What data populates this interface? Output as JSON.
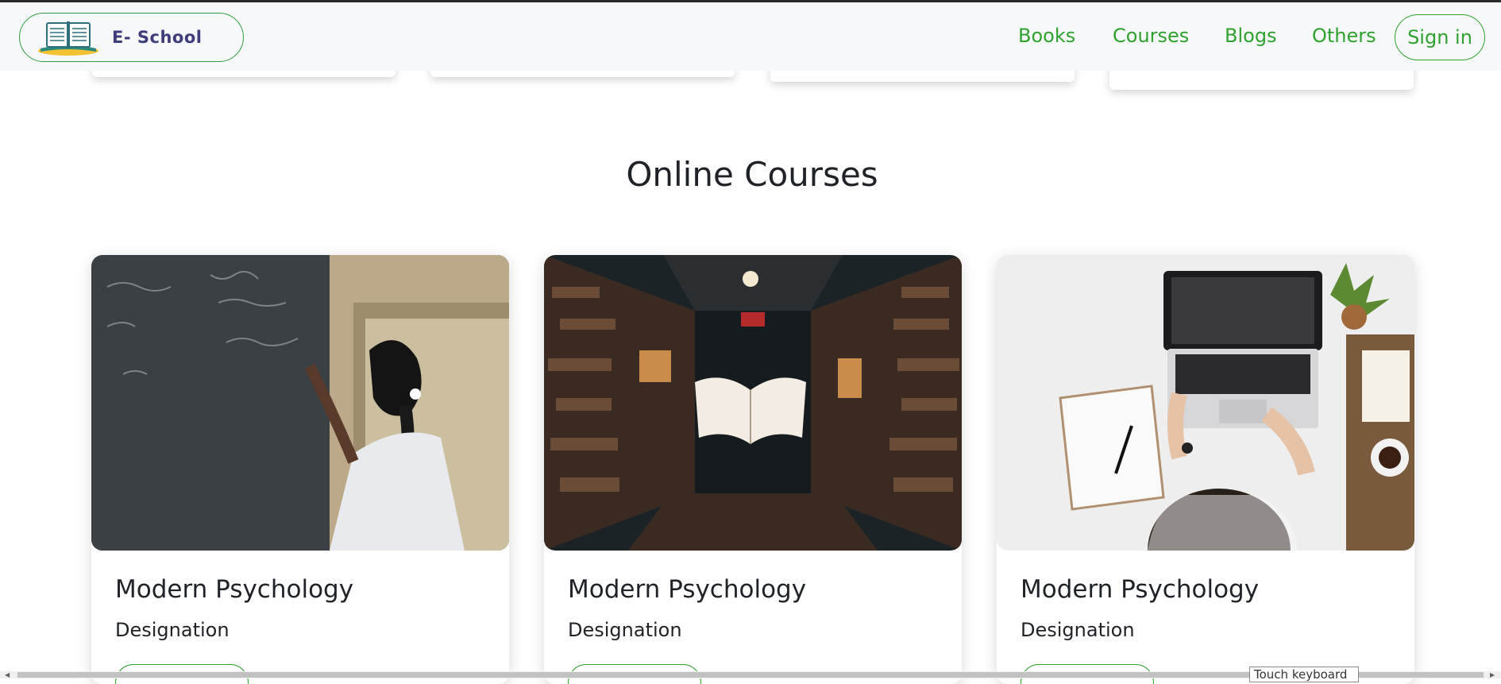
{
  "brand": {
    "name": "E- School"
  },
  "nav": {
    "links": [
      "Books",
      "Courses",
      "Blogs",
      "Others"
    ],
    "signin_label": "Sign in"
  },
  "section": {
    "title": "Online Courses"
  },
  "courses": [
    {
      "title": "Modern Psychology",
      "subtitle": "Designation",
      "image": "student-writing-on-chalkboard"
    },
    {
      "title": "Modern Psychology",
      "subtitle": "Designation",
      "image": "floating-book-in-library"
    },
    {
      "title": "Modern Psychology",
      "subtitle": "Designation",
      "image": "person-at-laptop-desk"
    }
  ],
  "tooltip": {
    "text": "Touch keyboard"
  },
  "colors": {
    "accent": "#2ea12e",
    "brand_text": "#3e3c7a",
    "navbar_bg": "#f7f8f9"
  }
}
